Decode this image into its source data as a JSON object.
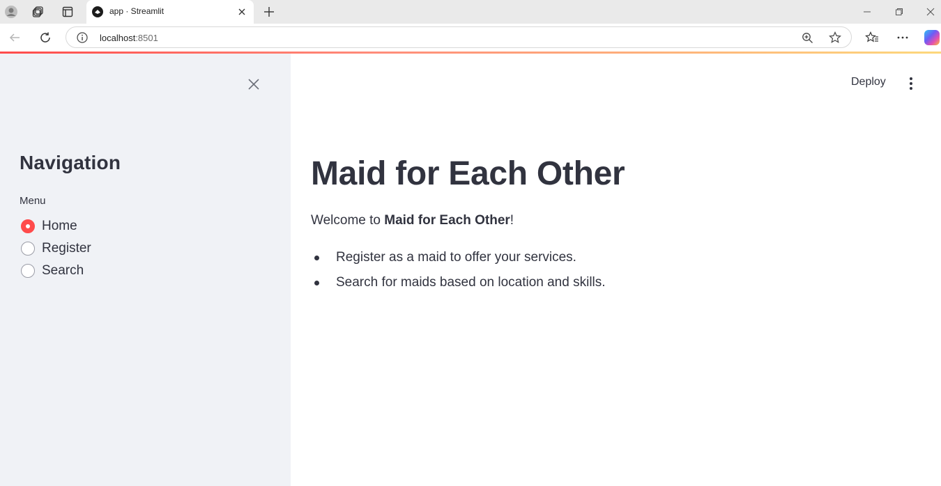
{
  "browser": {
    "tab_title": "app · Streamlit",
    "address": {
      "host": "localhost",
      "port": ":8501"
    }
  },
  "sidebar": {
    "title": "Navigation",
    "menu_label": "Menu",
    "options": [
      {
        "label": "Home",
        "selected": true
      },
      {
        "label": "Register",
        "selected": false
      },
      {
        "label": "Search",
        "selected": false
      }
    ]
  },
  "header": {
    "deploy_label": "Deploy"
  },
  "main": {
    "title": "Maid for Each Other",
    "welcome_prefix": "Welcome to ",
    "welcome_bold": "Maid for Each Other",
    "welcome_suffix": "!",
    "bullets": [
      "Register as a maid to offer your services.",
      "Search for maids based on location and skills."
    ]
  },
  "colors": {
    "accent": "#ff4b4b",
    "sidebar_bg": "#f0f2f6",
    "text": "#31333f"
  }
}
